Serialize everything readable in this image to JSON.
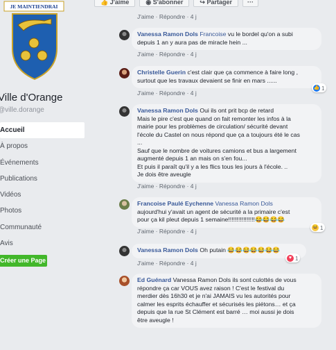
{
  "page": {
    "crest_motto": "JE MAINTIENDRAI",
    "name": "Ville d'Orange",
    "handle": "@ville.dorange"
  },
  "nav": {
    "items": [
      {
        "label": "Accueil",
        "active": true
      },
      {
        "label": "À propos"
      },
      {
        "label": "Événements"
      },
      {
        "label": "Publications"
      },
      {
        "label": "Vidéos"
      },
      {
        "label": "Photos"
      },
      {
        "label": "Communauté"
      },
      {
        "label": "Avis"
      }
    ],
    "create_page": "Créer une Page"
  },
  "action_bar": {
    "like": "J'aime",
    "subscribe": "S'abonner",
    "share": "Partager",
    "more": "···"
  },
  "comment_actions": {
    "like": "J'aime",
    "reply": "Répondre",
    "sep": "·"
  },
  "comments": [
    {
      "meta_only": true,
      "time": "4 j"
    },
    {
      "author": "Vanessa Ramon Dols",
      "mention": "Francoise",
      "lines": [
        "vu le bordel qu'on a subi",
        "depuis 1 an y aura pas de miracle hein ..."
      ],
      "time": "4 j"
    },
    {
      "author": "Christelle Guerin",
      "lines": [
        "c'est clair que ça commence à faire long ,",
        "surtout que les travaux devaient se finir en mars ......"
      ],
      "time": "4 j",
      "reaction": {
        "type": "like",
        "count": "1"
      }
    },
    {
      "author": "Vanessa Ramon Dols",
      "lines": [
        "Oui ils ont prit bcp de retard",
        "Mais le pire c'est que quand on fait remonter les infos à la",
        "mairie pour les problèmes de circulation/ sécurité devant",
        "l'école du Castel on nous répond que ça a toujours été le cas",
        "...",
        "Sauf que le nombre de voitures camions et bus a largement",
        "augmenté depuis 1 an mais on s'en fou...",
        "Et puis il paraît qu'il y a les flics tous les jours à l'école. ..",
        "Je dois être aveugle"
      ],
      "time": "4 j"
    },
    {
      "author": "Francoise Paulé Eychenne",
      "mention": "Vanessa Ramon Dols",
      "lines": [
        "aujourd'hui y'avait un agent de sécurité a la primaire c'est",
        "pour ça kil pleut depuis 1 semaine!!!!!!!!!!!!!!!!😂😂😂😂"
      ],
      "time": "4 j",
      "reaction": {
        "type": "haha",
        "count": "1"
      }
    },
    {
      "author": "Vanessa Ramon Dols",
      "lines": [
        "Oh putain 😂😂😂😂😂😂😂"
      ],
      "time": "4 j",
      "reaction": {
        "type": "love",
        "count": "1"
      }
    },
    {
      "author": "Ed Guénard",
      "lines": [
        "Vanessa Ramon Dols ils sont culottés de vous",
        "répondre ça car VOUS avez raison ! C'est le festival du",
        "merdier dès 16h30 et je n'ai JAMAIS vu les autorités pour",
        "calmer les esprits échauffer et sécurisés les piétons… et ça",
        "depuis que la rue St Clément est barré … moi aussi je dois",
        "être aveugle !"
      ]
    }
  ]
}
